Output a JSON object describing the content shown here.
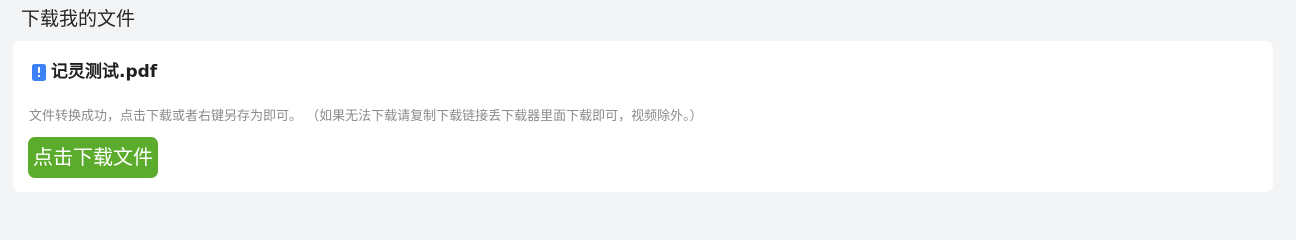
{
  "page": {
    "title": "下载我的文件"
  },
  "file": {
    "name": "记灵测试.pdf",
    "icon": "pdf-file-icon"
  },
  "info": {
    "message": "文件转换成功，点击下载或者右键另存为即可。 （如果无法下载请复制下载链接丢下载器里面下载即可，视频除外。）"
  },
  "actions": {
    "download_label": "点击下载文件"
  },
  "colors": {
    "background": "#f3f4f6",
    "card": "#ffffff",
    "button": "#5bac2c",
    "icon_accent": "#3b82f6"
  }
}
